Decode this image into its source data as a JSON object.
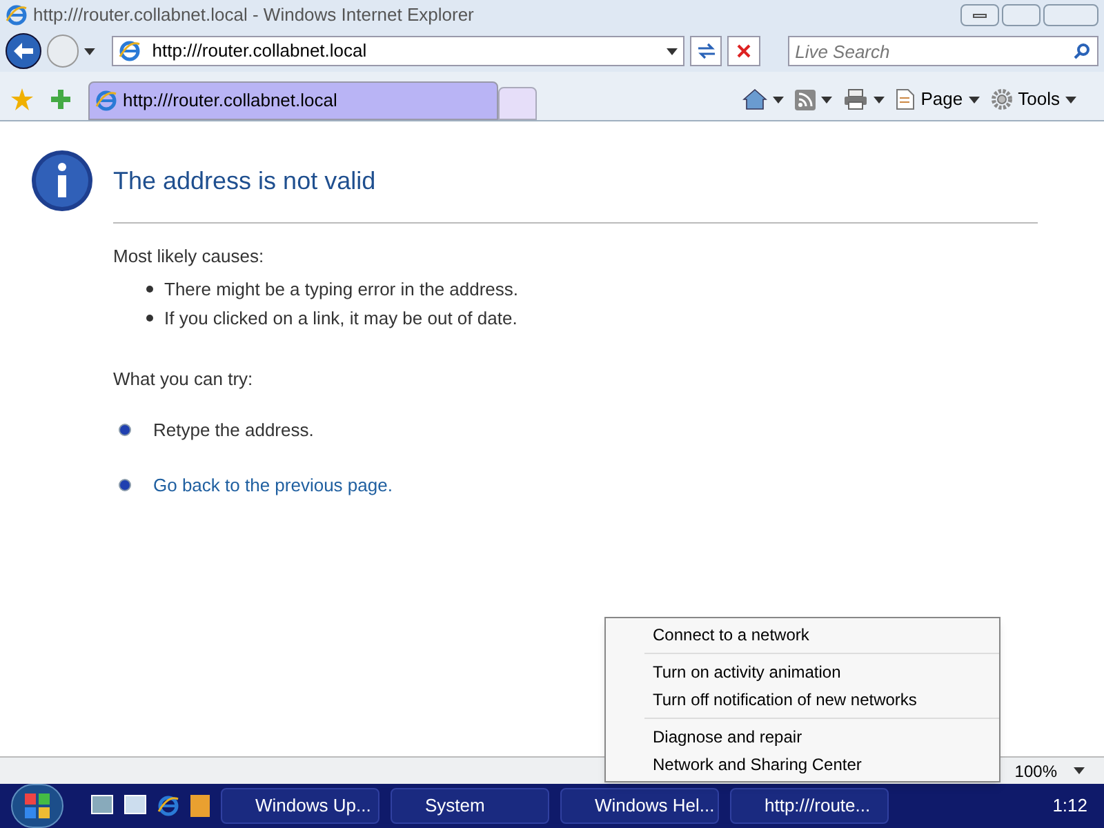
{
  "window": {
    "title": "http:///router.collabnet.local - Windows Internet Explorer"
  },
  "address_bar": {
    "value": "http:///router.collabnet.local"
  },
  "search": {
    "placeholder": "Live Search"
  },
  "tabs": [
    {
      "label": "http:///router.collabnet.local",
      "selected": true
    }
  ],
  "command_bar": [
    {
      "kind": "home"
    },
    {
      "kind": "feeds"
    },
    {
      "kind": "print"
    },
    {
      "label": "Page",
      "kind": "page"
    },
    {
      "label": "Tools",
      "kind": "tools"
    }
  ],
  "page": {
    "heading": "The address is not valid",
    "causes_title": "Most likely causes:",
    "causes": [
      "There might be a typing error in the address.",
      "If you clicked on a link, it may be out of date."
    ],
    "try_title": "What you can try:",
    "tries": [
      {
        "text": "Retype the address.",
        "kind": "text"
      },
      {
        "text": "Go back to the previous page.",
        "kind": "link"
      }
    ]
  },
  "status_bar": {
    "zoom": "100%"
  },
  "taskbar": {
    "buttons": [
      {
        "label": "Windows Up..."
      },
      {
        "label": "System"
      },
      {
        "label": "Windows Hel..."
      },
      {
        "label": "http:///route..."
      }
    ],
    "clock": "1:12"
  },
  "context_menu": [
    [
      "Connect to a network"
    ],
    [
      "Turn on activity animation",
      "Turn off notification of new networks"
    ],
    [
      "Diagnose and repair",
      "Network and Sharing Center"
    ]
  ]
}
